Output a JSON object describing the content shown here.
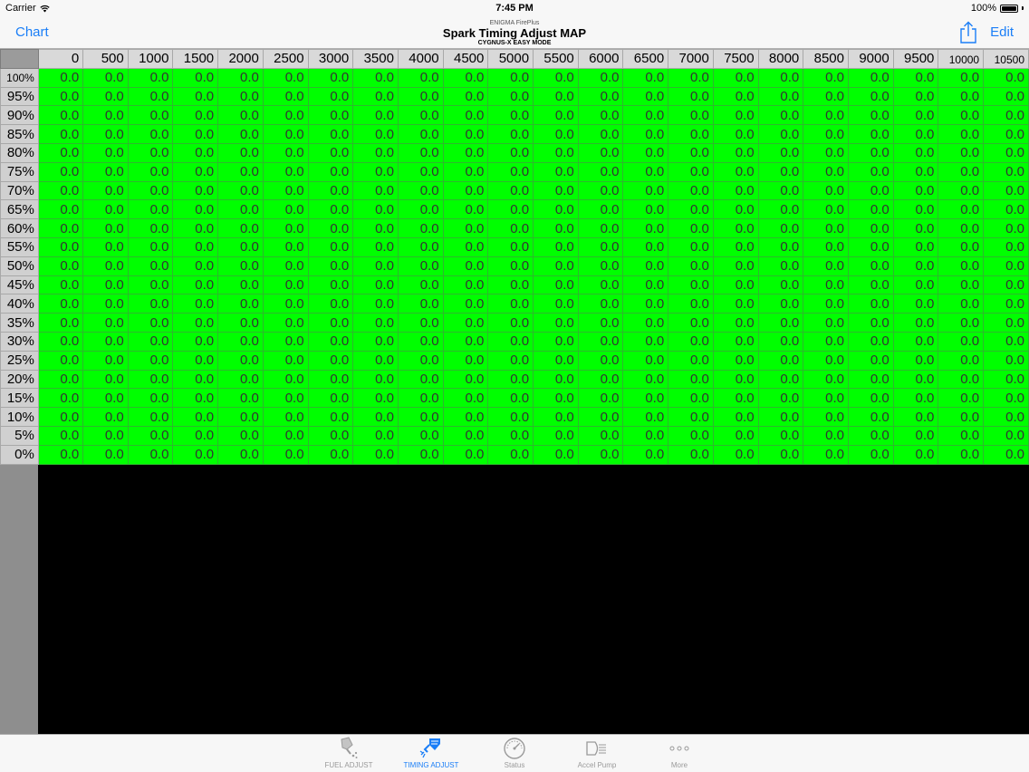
{
  "status_bar": {
    "carrier": "Carrier",
    "time": "7:45 PM",
    "battery": "100%"
  },
  "nav_bar": {
    "left_button": "Chart",
    "brand": "ENIGMA FirePlus",
    "title": "Spark Timing Adjust MAP",
    "subtitle": "CYGNUS-X EASY MODE",
    "right_button": "Edit",
    "share_icon": "share-icon"
  },
  "table": {
    "columns": [
      "0",
      "500",
      "1000",
      "1500",
      "2000",
      "2500",
      "3000",
      "3500",
      "4000",
      "4500",
      "5000",
      "5500",
      "6000",
      "6500",
      "7000",
      "7500",
      "8000",
      "8500",
      "9000",
      "9500",
      "10000",
      "10500"
    ],
    "rows": [
      "100%",
      "95%",
      "90%",
      "85%",
      "80%",
      "75%",
      "70%",
      "65%",
      "60%",
      "55%",
      "50%",
      "45%",
      "40%",
      "35%",
      "30%",
      "25%",
      "20%",
      "15%",
      "10%",
      "5%",
      "0%"
    ],
    "cell_value": "0.0",
    "cell_color": "#00ff00"
  },
  "tab_bar": {
    "active": 1,
    "tabs": [
      {
        "label": "FUEL ADJUST",
        "icon": "fuel-injector-icon"
      },
      {
        "label": "TIMING ADJUST",
        "icon": "spark-plug-icon"
      },
      {
        "label": "Status",
        "icon": "gauge-icon"
      },
      {
        "label": "Accel Pump",
        "icon": "headlight-icon"
      },
      {
        "label": "More",
        "icon": "more-dots-icon"
      }
    ]
  }
}
